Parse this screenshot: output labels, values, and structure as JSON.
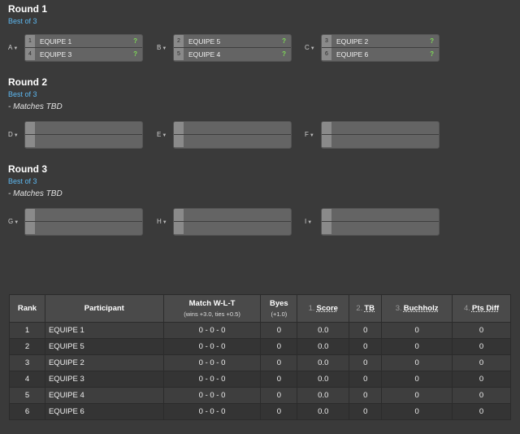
{
  "rounds": [
    {
      "title": "Round 1",
      "format": "Best of 3",
      "note": "",
      "matches": [
        {
          "id": "A",
          "slots": [
            {
              "seed": "1",
              "name": "EQUIPE 1",
              "status": "?"
            },
            {
              "seed": "4",
              "name": "EQUIPE 3",
              "status": "?"
            }
          ]
        },
        {
          "id": "B",
          "slots": [
            {
              "seed": "2",
              "name": "EQUIPE 5",
              "status": "?"
            },
            {
              "seed": "5",
              "name": "EQUIPE 4",
              "status": "?"
            }
          ]
        },
        {
          "id": "C",
          "slots": [
            {
              "seed": "3",
              "name": "EQUIPE 2",
              "status": "?"
            },
            {
              "seed": "6",
              "name": "EQUIPE 6",
              "status": "?"
            }
          ]
        }
      ]
    },
    {
      "title": "Round 2",
      "format": "Best of 3",
      "note": "- Matches TBD",
      "matches": [
        {
          "id": "D"
        },
        {
          "id": "E"
        },
        {
          "id": "F"
        }
      ]
    },
    {
      "title": "Round 3",
      "format": "Best of 3",
      "note": "- Matches TBD",
      "matches": [
        {
          "id": "G"
        },
        {
          "id": "H"
        },
        {
          "id": "I"
        }
      ]
    }
  ],
  "standings": {
    "headers": {
      "rank": "Rank",
      "participant": "Participant",
      "match_wlt": "Match W-L-T",
      "match_wlt_sub": "(wins +3.0, ties +0.5)",
      "byes": "Byes",
      "byes_sub": "(+1.0)",
      "score_num": "1.",
      "score": "Score",
      "tb_num": "2.",
      "tb": "TB",
      "buchholz_num": "3.",
      "buchholz": "Buchholz",
      "ptsdiff_num": "4.",
      "ptsdiff": "Pts Diff"
    },
    "rows": [
      {
        "rank": "1",
        "participant": "EQUIPE 1",
        "wlt": "0 - 0 - 0",
        "byes": "0",
        "score": "0.0",
        "tb": "0",
        "buchholz": "0",
        "ptsdiff": "0"
      },
      {
        "rank": "2",
        "participant": "EQUIPE 5",
        "wlt": "0 - 0 - 0",
        "byes": "0",
        "score": "0.0",
        "tb": "0",
        "buchholz": "0",
        "ptsdiff": "0"
      },
      {
        "rank": "3",
        "participant": "EQUIPE 2",
        "wlt": "0 - 0 - 0",
        "byes": "0",
        "score": "0.0",
        "tb": "0",
        "buchholz": "0",
        "ptsdiff": "0"
      },
      {
        "rank": "4",
        "participant": "EQUIPE 3",
        "wlt": "0 - 0 - 0",
        "byes": "0",
        "score": "0.0",
        "tb": "0",
        "buchholz": "0",
        "ptsdiff": "0"
      },
      {
        "rank": "5",
        "participant": "EQUIPE 4",
        "wlt": "0 - 0 - 0",
        "byes": "0",
        "score": "0.0",
        "tb": "0",
        "buchholz": "0",
        "ptsdiff": "0"
      },
      {
        "rank": "6",
        "participant": "EQUIPE 6",
        "wlt": "0 - 0 - 0",
        "byes": "0",
        "score": "0.0",
        "tb": "0",
        "buchholz": "0",
        "ptsdiff": "0"
      }
    ]
  },
  "colors": {
    "background": "#3a3a3a",
    "accent_blue": "#5db8f0",
    "status_green": "#7ed957",
    "match_box": "#646464"
  },
  "icons": {
    "match_menu": "caret-down-icon",
    "status": "question-mark-icon"
  }
}
